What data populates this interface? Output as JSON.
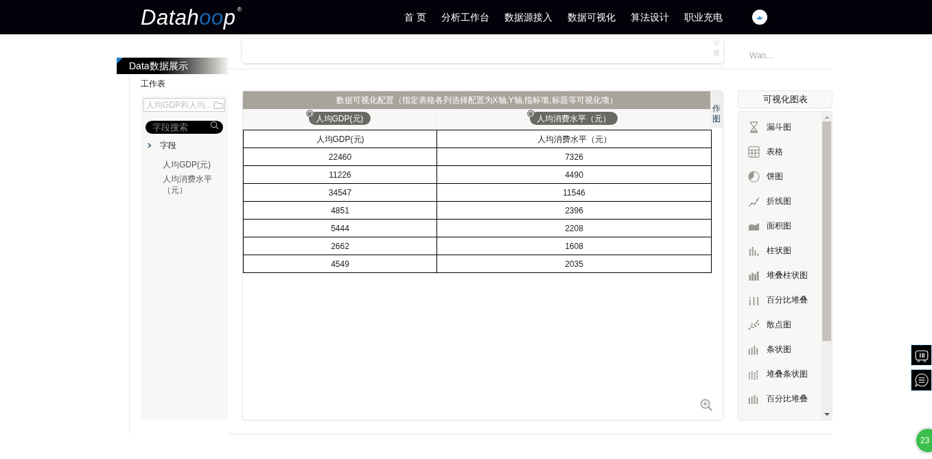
{
  "header": {
    "logo": {
      "parts": [
        {
          "text": "Datah",
          "accent": false
        },
        {
          "text": "oo",
          "accent": true
        },
        {
          "text": "p",
          "accent": false
        }
      ],
      "mark": "®"
    },
    "nav": [
      {
        "label": "首 页"
      },
      {
        "label": "分析工作台"
      },
      {
        "label": "数据源接入"
      },
      {
        "label": "数据可视化"
      },
      {
        "label": "算法设计"
      },
      {
        "label": "职业充电"
      }
    ]
  },
  "sidebar": {
    "title": "Data数据展示",
    "section": "工作表",
    "file_field": {
      "value": "人均GDP和人均..."
    },
    "search": {
      "placeholder": "字段搜索"
    },
    "tree": {
      "label": "字段",
      "expanded": true,
      "children": [
        {
          "label": "人均GDP(元)"
        },
        {
          "label": "人均消费水平（元）"
        }
      ]
    }
  },
  "top_panel": {
    "side_label": "Wan..."
  },
  "config": {
    "title": "数据可视化配置（指定表格各列选择配置为X轴,Y轴,指标项,标题等可视化项）",
    "tags": [
      {
        "label": "人均GDP(元)"
      },
      {
        "label": "人均消费水平（元）"
      }
    ],
    "draw_button": "作图"
  },
  "table": {
    "columns": [
      "人均GDP(元)",
      "人均消费水平（元）"
    ],
    "rows": [
      [
        "22460",
        "7326"
      ],
      [
        "11226",
        "4490"
      ],
      [
        "34547",
        "11546"
      ],
      [
        "4851",
        "2396"
      ],
      [
        "5444",
        "2208"
      ],
      [
        "2662",
        "1608"
      ],
      [
        "4549",
        "2035"
      ]
    ]
  },
  "charts_panel": {
    "title": "可视化图表",
    "items": [
      {
        "label": "漏斗图"
      },
      {
        "label": "表格"
      },
      {
        "label": "饼图"
      },
      {
        "label": "折线图"
      },
      {
        "label": "面积图"
      },
      {
        "label": "柱状图"
      },
      {
        "label": "堆叠柱状图"
      },
      {
        "label": "百分比堆叠"
      },
      {
        "label": "散点图"
      },
      {
        "label": "条状图"
      },
      {
        "label": "堆叠条状图"
      },
      {
        "label": "百分比堆叠"
      }
    ]
  },
  "badge": {
    "count": "23"
  }
}
